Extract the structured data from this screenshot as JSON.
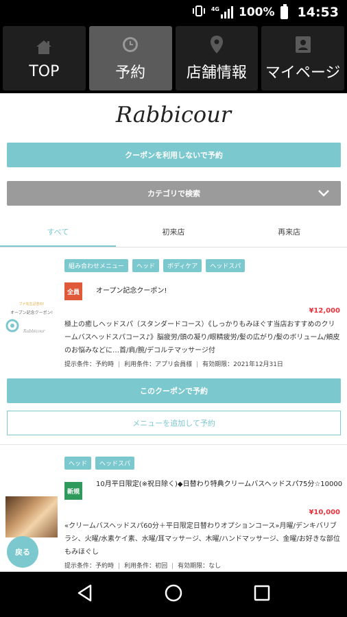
{
  "status_bar": {
    "network": "4G",
    "battery": "100%",
    "time": "14:53"
  },
  "nav_tabs": [
    {
      "label": "TOP",
      "icon": "home-icon"
    },
    {
      "label": "予約",
      "icon": "clock-icon"
    },
    {
      "label": "店舗情報",
      "icon": "location-pin-icon"
    },
    {
      "label": "マイページ",
      "icon": "id-card-icon"
    }
  ],
  "brand": {
    "logo_text": "Rabbicour"
  },
  "actions": {
    "reserve_without_coupon": "クーポンを利用しないで予約",
    "category_search": "カテゴリで検索"
  },
  "segments": [
    "すべて",
    "初来店",
    "再来店"
  ],
  "coupons": [
    {
      "tags": [
        "組み合わせメニュー",
        "ヘッド",
        "ボディケア",
        "ヘッドスパ"
      ],
      "badge": "全員",
      "badge_color": "#e05a3a",
      "title": "オープン記念クーポン!",
      "price": "¥12,000",
      "description": "極上の癒しヘッドスパ（スタンダードコース）《しっかりもみほぐす当店おすすめのクリームバスヘッドスパコース♪》脳疲労/頭の凝り/眼精疲労/髪の広がり/髪のボリューム/頬皮のお悩みなどに…首/肩/腕/デコルテマッサージ付",
      "meta": [
        "提示条件：予約時",
        "利用条件：アプリ会員様",
        "有効期限：2021年12月31日"
      ],
      "reserve_label": "このクーポンで予約",
      "add_menu_label": "メニューを追加して予約"
    },
    {
      "tags": [
        "ヘッド",
        "ヘッドスパ"
      ],
      "badge": "新規",
      "badge_color": "#2e9a5c",
      "title": "10月平日限定(※祝日除く)◆日替わり特典クリームバスヘッドスパ75分☆10000",
      "price": "¥10,000",
      "description": "«クリームバスヘッドスパ60分＋平日限定日替わりオプションコース»月曜/デンキバリブラシ、火曜/水素ケイ素、水曜/耳マッサージ、木曜/ハンドマッサージ、金曜/お好きな部位もみほぐし",
      "meta": [
        "提示条件：予約時",
        "利用条件：初回",
        "有効期限：なし"
      ]
    }
  ],
  "thumb_text": {
    "line1": "ブナ先生記念日!",
    "line2": "オープン記念クーポン!",
    "line3": "Rabbicour"
  },
  "back_label": "戻る"
}
